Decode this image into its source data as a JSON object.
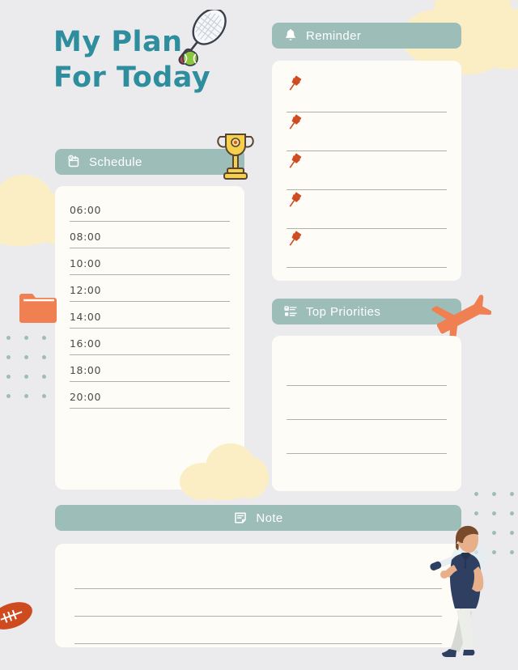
{
  "page": {
    "background_color": "#ebebed",
    "card_color": "#fdfcf6",
    "accent_sage": "#9dbdb8",
    "accent_teal": "#2e8e9e",
    "accent_orange": "#f07f52",
    "accent_red": "#ce4a1f",
    "line_color": "#b5b0a4",
    "cloud_color": "#fbeec4"
  },
  "title": {
    "line1": "My Plan",
    "line2": "For Today"
  },
  "sections": {
    "reminder": {
      "label": "Reminder",
      "icon": "bell-icon",
      "rows": 5,
      "row_icon": "pushpin-icon"
    },
    "schedule": {
      "label": "Schedule",
      "icon": "calendar-clock-icon",
      "times": [
        "06:00",
        "08:00",
        "10:00",
        "12:00",
        "14:00",
        "16:00",
        "18:00",
        "20:00"
      ]
    },
    "top_priorities": {
      "label": "Top Priorities",
      "icon": "checklist-icon",
      "lines": 3
    },
    "note": {
      "label": "Note",
      "icon": "note-icon",
      "lines": 3
    }
  },
  "decorations": [
    {
      "name": "tennis-racket-illustration",
      "colors": [
        "#ffffff",
        "#3b3f4a",
        "#d93b5e"
      ]
    },
    {
      "name": "tennis-ball-illustration",
      "colors": [
        "#8cc63f",
        "#ffffff"
      ]
    },
    {
      "name": "trophy-illustration",
      "colors": [
        "#f5d04e",
        "#5a4630",
        "#e05a2b"
      ]
    },
    {
      "name": "folder-illustration",
      "colors": [
        "#f07f52",
        "#fdfcf6"
      ]
    },
    {
      "name": "airplane-illustration",
      "colors": [
        "#f07f52"
      ]
    },
    {
      "name": "football-illustration",
      "colors": [
        "#ce4a1f",
        "#ffffff"
      ]
    },
    {
      "name": "person-with-bat-illustration",
      "colors": [
        "#2e3f62",
        "#e8e8e4",
        "#7a4b2a",
        "#e8b08a"
      ]
    },
    {
      "name": "cloud-shape",
      "count": 3,
      "color": "#fbeec4"
    },
    {
      "name": "dot-grid",
      "count": 2,
      "color": "#9dbdb8"
    }
  ]
}
